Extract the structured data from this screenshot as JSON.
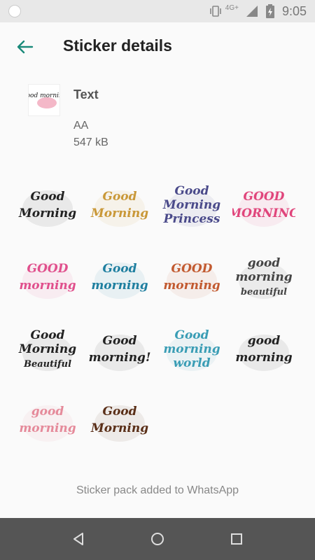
{
  "status": {
    "network": "4G+",
    "time": "9:05"
  },
  "header": {
    "title": "Sticker details"
  },
  "pack": {
    "thumb_text": "Good morning",
    "name": "Text",
    "author": "AA",
    "size": "547 kB"
  },
  "stickers": [
    {
      "line1": "Good",
      "line2": "Morning",
      "line3": "",
      "color": "#222222"
    },
    {
      "line1": "Good",
      "line2": "Morning",
      "line3": "",
      "color": "#c99838"
    },
    {
      "line1": "Good",
      "line2": "Morning",
      "line3": "Princess",
      "color": "#4a4a8a"
    },
    {
      "line1": "GOOD",
      "line2": "MORNING",
      "line3": "",
      "color": "#e0457b"
    },
    {
      "line1": "GOOD",
      "line2": "morning",
      "line3": "",
      "color": "#e04f8c"
    },
    {
      "line1": "Good",
      "line2": "morning",
      "line3": "",
      "color": "#1f7fa0"
    },
    {
      "line1": "GOOD",
      "line2": "morning",
      "line3": "",
      "color": "#c25a30"
    },
    {
      "line1": "good",
      "line2": "morning",
      "line3": "beautiful",
      "color": "#444444"
    },
    {
      "line1": "Good",
      "line2": "Morning",
      "line3": "Beautiful",
      "color": "#222222"
    },
    {
      "line1": "Good",
      "line2": "morning!",
      "line3": "",
      "color": "#222222"
    },
    {
      "line1": "Good",
      "line2": "morning",
      "line3": "world",
      "color": "#3a9db5"
    },
    {
      "line1": "good",
      "line2": "morning",
      "line3": "",
      "color": "#222222"
    },
    {
      "line1": "good",
      "line2": "morning",
      "line3": "",
      "color": "#e58a9a"
    },
    {
      "line1": "Good",
      "line2": "Morning",
      "line3": "",
      "color": "#5a2f18"
    }
  ],
  "footer": {
    "message": "Sticker pack added to WhatsApp"
  },
  "colors": {
    "accent": "#1a8a7a",
    "nav_bar": "#555555"
  }
}
